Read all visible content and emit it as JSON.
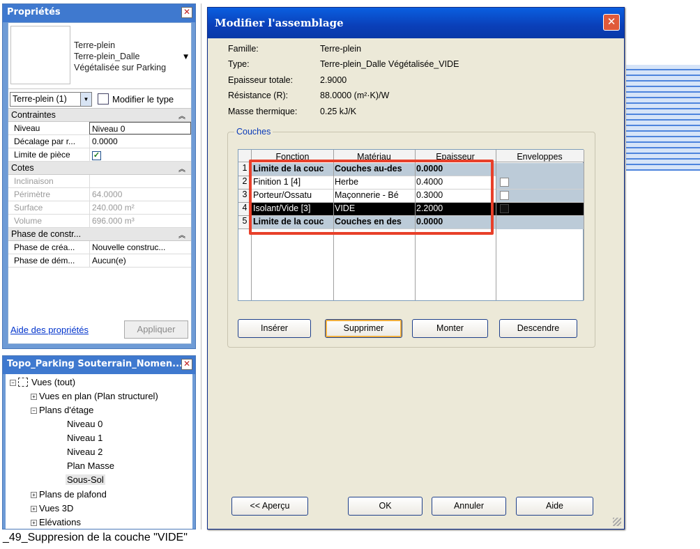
{
  "properties": {
    "title": "Propriétés",
    "type_name_lines": [
      "Terre-plein",
      "Terre-plein_Dalle",
      "Végétalisée sur Parking"
    ],
    "filter_value": "Terre-plein (1)",
    "edit_type_label": "Modifier le type",
    "groups": [
      {
        "name": "Contraintes",
        "rows": [
          {
            "key": "Niveau",
            "value": "Niveau 0"
          },
          {
            "key": "Décalage par r...",
            "value": "0.0000"
          },
          {
            "key": "Limite de pièce",
            "value": "✓"
          }
        ]
      },
      {
        "name": "Cotes",
        "rows": [
          {
            "key": "Inclinaison",
            "value": ""
          },
          {
            "key": "Périmètre",
            "value": "64.0000"
          },
          {
            "key": "Surface",
            "value": "240.000 m²"
          },
          {
            "key": "Volume",
            "value": "696.000 m³"
          }
        ]
      },
      {
        "name": "Phase de constr...",
        "rows": [
          {
            "key": "Phase de créa...",
            "value": "Nouvelle construc..."
          },
          {
            "key": "Phase de dém...",
            "value": "Aucun(e)"
          }
        ]
      }
    ],
    "help_link": "Aide des propriétés",
    "apply_label": "Appliquer"
  },
  "browser": {
    "title": "Topo_Parking Souterrain_Nomen...",
    "nodes": [
      {
        "label": "Vues (tout)",
        "toggle": "−"
      },
      {
        "label": "Vues en plan (Plan structurel)",
        "toggle": "+"
      },
      {
        "label": "Plans d'étage",
        "toggle": "−"
      },
      {
        "label": "Niveau 0"
      },
      {
        "label": "Niveau 1"
      },
      {
        "label": "Niveau 2"
      },
      {
        "label": "Plan Masse"
      },
      {
        "label": "Sous-Sol"
      },
      {
        "label": "Plans de plafond",
        "toggle": "+"
      },
      {
        "label": "Vues 3D",
        "toggle": "+"
      },
      {
        "label": "Elévations",
        "toggle": "+"
      }
    ]
  },
  "dialog": {
    "title": "Modifier l'assemblage",
    "close_glyph": "✕",
    "info": [
      {
        "label": "Famille:",
        "value": "Terre-plein"
      },
      {
        "label": "Type:",
        "value": "Terre-plein_Dalle Végétalisée_VIDE"
      },
      {
        "label": "Epaisseur totale:",
        "value": "2.9000"
      },
      {
        "label": "Résistance (R):",
        "value": "88.0000 (m²·K)/W"
      },
      {
        "label": "Masse thermique:",
        "value": "0.25 kJ/K"
      }
    ],
    "layers_group": "Couches",
    "columns": [
      "Fonction",
      "Matériau",
      "Epaisseur",
      "Enveloppes"
    ],
    "rows": [
      {
        "num": "1",
        "fonction": "Limite de la couc",
        "materiau": "Couches au-des",
        "epaisseur": "0.0000",
        "bold": true
      },
      {
        "num": "2",
        "fonction": "Finition 1 [4]",
        "materiau": "Herbe",
        "epaisseur": "0.4000"
      },
      {
        "num": "3",
        "fonction": "Porteur/Ossatu",
        "materiau": "Maçonnerie - Bé",
        "epaisseur": "0.3000"
      },
      {
        "num": "4",
        "fonction": "Isolant/Vide [3]",
        "materiau": "VIDE",
        "epaisseur": "2.2000",
        "selected": true
      },
      {
        "num": "5",
        "fonction": "Limite de la couc",
        "materiau": "Couches en des",
        "epaisseur": "0.0000",
        "bold": true
      }
    ],
    "buttons": {
      "insert": "Insérer",
      "delete": "Supprimer",
      "up": "Monter",
      "down": "Descendre",
      "preview": "<< Aperçu",
      "ok": "OK",
      "cancel": "Annuler",
      "help": "Aide"
    }
  },
  "caption": "_49_Suppresion  de la couche \"VIDE\"",
  "colors": {
    "highlight_box": "#e8402a",
    "selected_row": "#000000",
    "title_bar": "#0a4fd0"
  }
}
